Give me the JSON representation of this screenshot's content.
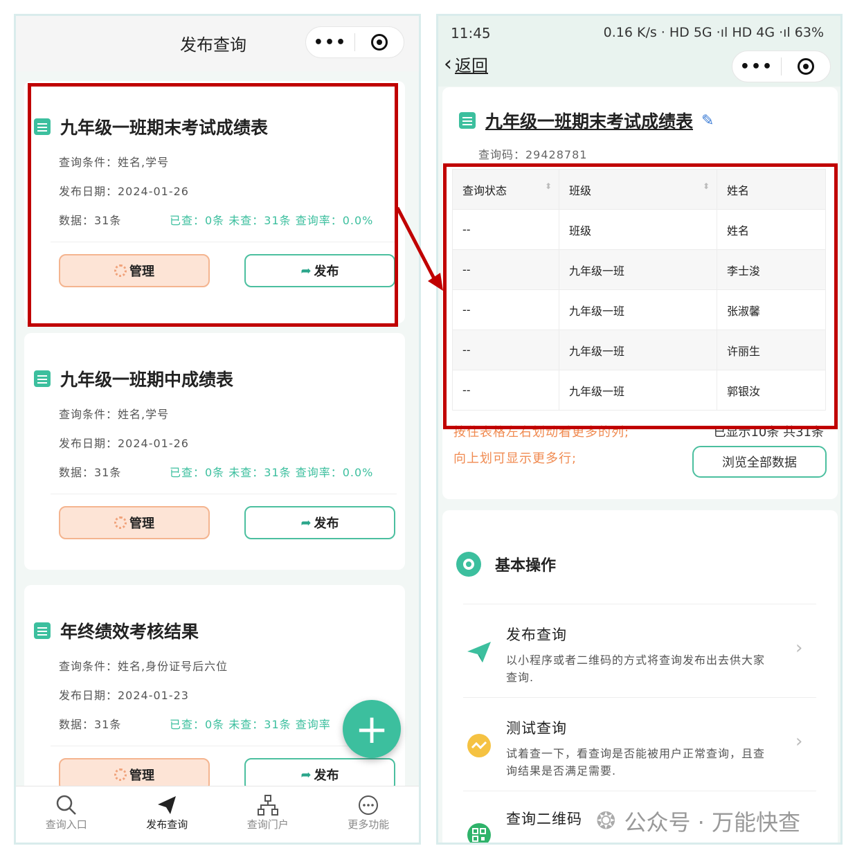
{
  "left": {
    "header_title": "发布查询",
    "capsule_dots": "•••",
    "cards": [
      {
        "title": "九年级一班期末考试成绩表",
        "query_cond": "查询条件：姓名,学号",
        "publish_date": "发布日期：2024-01-26",
        "data_count": "数据：31条",
        "stats": "已查：0条  未查：31条  查询率：0.0%",
        "manage_label": "管理",
        "publish_label": "发布"
      },
      {
        "title": "九年级一班期中成绩表",
        "query_cond": "查询条件：姓名,学号",
        "publish_date": "发布日期：2024-01-26",
        "data_count": "数据：31条",
        "stats": "已查：0条  未查：31条  查询率：0.0%",
        "manage_label": "管理",
        "publish_label": "发布"
      },
      {
        "title": "年终绩效考核结果",
        "query_cond": "查询条件：姓名,身份证号后六位",
        "publish_date": "发布日期：2024-01-23",
        "data_count": "数据：31条",
        "stats": "已查：0条  未查：31条  查询率",
        "manage_label": "管理",
        "publish_label": "发布"
      }
    ],
    "fab_label": "+",
    "tabs": [
      {
        "label": "查询入口",
        "icon": "search-icon"
      },
      {
        "label": "发布查询",
        "icon": "paper-plane-icon"
      },
      {
        "label": "查询门户",
        "icon": "sitemap-icon"
      },
      {
        "label": "更多功能",
        "icon": "more-circle-icon"
      }
    ]
  },
  "right": {
    "status": {
      "time": "11:45",
      "right": "0.16 K/s · HD 5G ·ıl HD 4G ·ıl 63%"
    },
    "back_label": "返回",
    "title": "九年级一班期末考试成绩表",
    "code": "查询码：29428781",
    "table": {
      "headers": [
        "查询状态",
        "班级",
        "姓名"
      ],
      "rows": [
        [
          "--",
          "班级",
          "姓名"
        ],
        [
          "--",
          "九年级一班",
          "李士浚"
        ],
        [
          "--",
          "九年级一班",
          "张淑馨"
        ],
        [
          "--",
          "九年级一班",
          "许丽生"
        ],
        [
          "--",
          "九年级一班",
          "郭银汝"
        ]
      ]
    },
    "hint1": "按住表格左右划动看更多的列;",
    "hint2": "向上划可显示更多行;",
    "count": "已显示10条 共31条",
    "browse_label": "浏览全部数据",
    "section_title": "基本操作",
    "ops": [
      {
        "title": "发布查询",
        "desc": "以小程序或者二维码的方式将查询发布出去供大家查询.",
        "icon": "paper-plane-icon"
      },
      {
        "title": "测试查询",
        "desc": "试着查一下，看查询是否能被用户正常查询，且查询结果是否满足需要.",
        "icon": "test-icon"
      },
      {
        "title": "查询二维码",
        "desc": "",
        "icon": "qrcode-icon"
      }
    ],
    "watermark": "公众号 · 万能快查"
  },
  "colors": {
    "accent": "#3cbf9e",
    "highlight_box": "#c00000",
    "manage_bg": "#fde4d6",
    "hint": "#f08a50"
  }
}
